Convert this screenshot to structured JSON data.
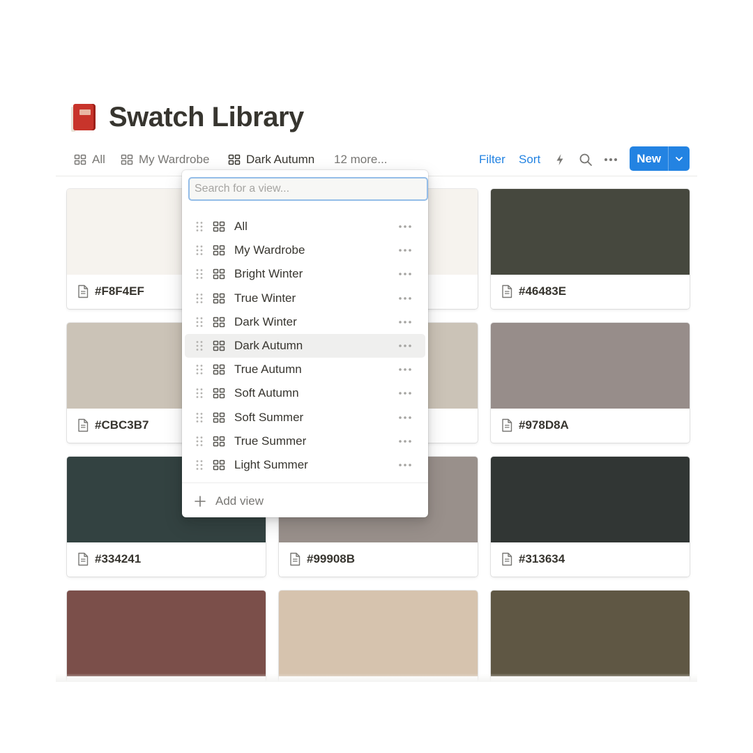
{
  "page": {
    "title": "Swatch Library",
    "icon": "red-book-icon"
  },
  "tabs": [
    {
      "label": "All",
      "icon": "grid-icon"
    },
    {
      "label": "My Wardrobe",
      "icon": "grid-icon"
    },
    {
      "label": "Dark Autumn",
      "icon": "grid-icon",
      "active": true
    },
    {
      "label": "12 more..."
    }
  ],
  "toolbar": {
    "filter_label": "Filter",
    "sort_label": "Sort",
    "automation_icon": "lightning-icon",
    "search_icon": "search-icon",
    "more_icon": "more-horizontal-icon",
    "new_label": "New",
    "new_dropdown_icon": "chevron-down-icon",
    "accent": "#2383e2"
  },
  "cards": [
    {
      "name": "#F8F4EF",
      "color": "#F6F3EE"
    },
    {
      "name": "",
      "color": "#F6F3EE"
    },
    {
      "name": "#46483E",
      "color": "#46483E"
    },
    {
      "name": "#CBC3B7",
      "color": "#CBC3B7"
    },
    {
      "name": "",
      "color": "#CBC3B7"
    },
    {
      "name": "#978D8A",
      "color": "#978D8A"
    },
    {
      "name": "#334241",
      "color": "#334241"
    },
    {
      "name": "#99908B",
      "color": "#99908B"
    },
    {
      "name": "#313634",
      "color": "#313634"
    },
    {
      "name": "",
      "color": "#7B4F4A"
    },
    {
      "name": "",
      "color": "#D6C3AE"
    },
    {
      "name": "",
      "color": "#5F5744"
    }
  ],
  "view_menu": {
    "search_placeholder": "Search for a view...",
    "items": [
      {
        "label": "All"
      },
      {
        "label": "My Wardrobe"
      },
      {
        "label": "Bright Winter"
      },
      {
        "label": "True Winter"
      },
      {
        "label": "Dark Winter"
      },
      {
        "label": "Dark Autumn",
        "highlighted": true
      },
      {
        "label": "True Autumn"
      },
      {
        "label": "Soft Autumn"
      },
      {
        "label": "Soft Summer"
      },
      {
        "label": "True Summer"
      },
      {
        "label": "Light Summer"
      }
    ],
    "add_view_label": "Add view"
  }
}
